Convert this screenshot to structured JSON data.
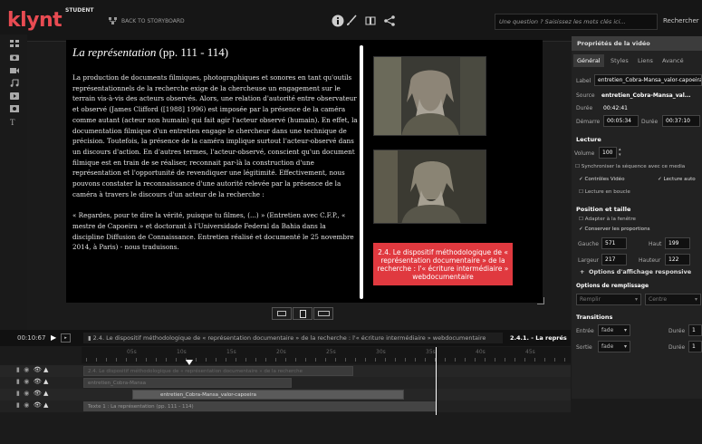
{
  "app": {
    "logo": "klynt",
    "edition": "STUDENT",
    "back_label": "BACK TO STORYBOARD",
    "search_placeholder": "Une question ? Saisissez les mots clés ici...",
    "search_button": "Rechercher",
    "toolbar_icons": [
      "info-icon",
      "brush-icon",
      "book-icon",
      "share-icon"
    ]
  },
  "sidebar_tools": [
    "grid-icon",
    "camera-icon",
    "video-icon",
    "music-icon",
    "film-icon",
    "image-icon",
    "text-icon"
  ],
  "stage": {
    "title_italic": "La représentation",
    "title_pages": " (pp. 111 - 114)",
    "paragraphs": [
      "La production de documents filmiques, photographiques et sonores en tant qu'outils représentationnels de la recherche exige de la chercheuse un engagement sur le terrain vis-à-vis des acteurs observés. Alors, une relation d'autorité entre observateur et observé (James Clifford ([1988] 1996) est imposée par la présence de la caméra comme autant (acteur non humain) qui fait agir l'acteur observé (humain). En effet, la documentation filmique d'un entretien engage le chercheur dans une technique de précision. Toutefois, la présence de la caméra implique surtout l'acteur-observé dans un discours d'action. En d'autres termes, l'acteur-observé, conscient qu'un document filmique est en train de se réaliser, reconnait par-là la construction d'une représentation et l'opportunité de revendiquer une légitimité. Effectivement, nous pouvons constater la reconnaissance d'une autorité relevée par la présence de la caméra à travers le discours d'un acteur de la recherche :",
      "« Regardes, pour te dire la vérité, puisque tu filmes, (...) » (Entretien avec C.F.P., « mestre de Capoeira » et doctorant à l'Universidade Federal da Bahia dans la discipline Diffusion de Connaissance. Entretien réalisé et documenté le 25 novembre 2014, à Paris) - nous traduisons."
    ],
    "banner": "2.4. Le dispositif méthodologique de « représentation documentaire » de la recherche : l'« écriture intermédiaire » webdocumentaire"
  },
  "properties": {
    "header": "Propriétés de la vidéo",
    "tabs": [
      "Général",
      "Styles",
      "Liens",
      "Avancé"
    ],
    "active_tab": "Général",
    "label_key": "Label",
    "label_value": "entretien_Cobra-Mansa_valor-capoeira",
    "source_key": "Source",
    "source_value": "entretien_Cobra-Mansa_val...",
    "duree_key": "Durée",
    "duree_value": "00:42:41",
    "demarre_key": "Démarre",
    "demarre_value": "00:05:34",
    "duree2_key": "Durée",
    "duree2_value": "00:37:10",
    "lecture_title": "Lecture",
    "volume_key": "Volume",
    "volume_value": "100",
    "sync_label": "Synchroniser la séquence avec ce media",
    "controles_label": "Contrôles Vidéo",
    "lecture_auto_label": "Lecture auto",
    "boucle_label": "Lecture en boucle",
    "position_title": "Position et taille",
    "adapter_label": "Adapter à la fenêtre",
    "conserver_label": "Conserver les proportions",
    "gauche_key": "Gauche",
    "gauche_value": "571",
    "haut_key": "Haut",
    "haut_value": "199",
    "largeur_key": "Largeur",
    "largeur_value": "217",
    "hauteur_key": "Hauteur",
    "hauteur_value": "122",
    "options_affichage": "Options d'affichage responsive",
    "remplissage_title": "Options de remplissage",
    "remplir": "Remplir",
    "centre": "Centre",
    "transitions_title": "Transitions",
    "entree_key": "Entrée",
    "entree_value": "fade",
    "entree_duree_key": "Durée",
    "entree_duree_value": "1",
    "sortie_key": "Sortie",
    "sortie_value": "fade",
    "sortie_duree_key": "Durée",
    "sortie_duree_value": "1"
  },
  "timeline": {
    "timecode": "00:10:67",
    "tab_inactive": "2.4. Le dispositif méthodologique de « représentation documentaire » de la recherche : l'« écriture intermédiaire » webdocumentaire",
    "tab_active": "2.4.1. - La représ",
    "ruler_labels": [
      "05s",
      "10s",
      "15s",
      "20s",
      "25s",
      "30s",
      "35s",
      "40s",
      "45s"
    ],
    "clips": [
      "2.4. Le dispositif méthodologique de « représentation documentaire » de la recherche",
      "entretien_Cobra-Mansa",
      "entretien_Cobra-Mansa_valor-capoeira",
      "Texte 1 : La représentation (pp. 111 - 114)"
    ]
  }
}
